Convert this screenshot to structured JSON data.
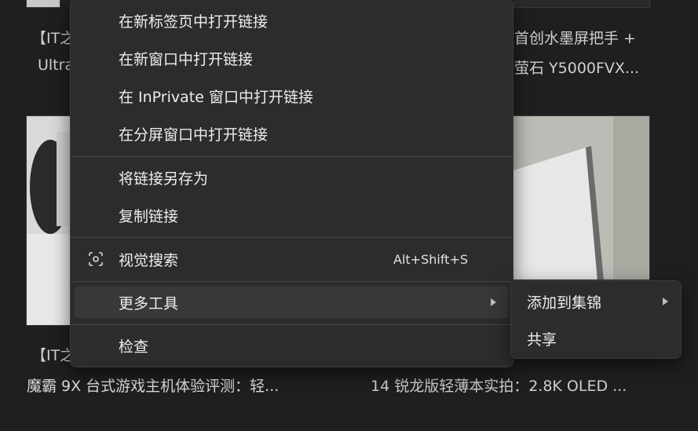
{
  "background": {
    "card_title_left_1": "【IT之",
    "card_title_left_2": "Ultra",
    "card_title_left_3": "【IT之",
    "card_title_right_1": "首创水墨屏把手 +",
    "card_title_right_2": "萤石 Y5000FVX...",
    "card_caption_left": "魔霸 9X 台式游戏主机体验评测：轻...",
    "card_caption_right": "14 锐龙版轻薄本实拍：2.8K OLED ..."
  },
  "context_menu": {
    "items": [
      {
        "label": "在新标签页中打开链接"
      },
      {
        "label": "在新窗口中打开链接"
      },
      {
        "label": "在 InPrivate 窗口中打开链接"
      },
      {
        "label": "在分屏窗口中打开链接"
      },
      {
        "label": "将链接另存为"
      },
      {
        "label": "复制链接"
      },
      {
        "label": "视觉搜索",
        "shortcut": "Alt+Shift+S",
        "icon": "visual-search-icon"
      },
      {
        "label": "更多工具",
        "icon": "chevron-right-icon"
      },
      {
        "label": "检查"
      }
    ]
  },
  "submenu": {
    "items": [
      {
        "label": "添加到集锦",
        "icon": "chevron-right-icon"
      },
      {
        "label": "共享"
      }
    ]
  }
}
